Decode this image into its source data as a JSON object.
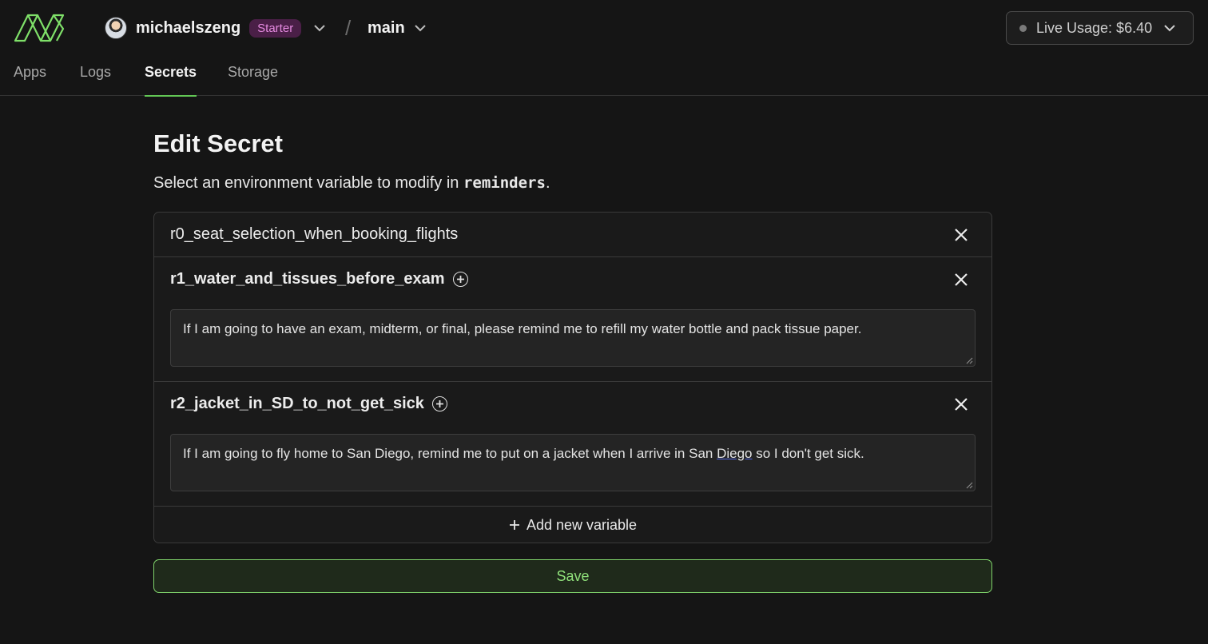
{
  "header": {
    "username": "michaelszeng",
    "plan_badge": "Starter",
    "separator": "/",
    "environment": "main",
    "live_usage": "Live Usage: $6.40"
  },
  "tabs": [
    {
      "label": "Apps",
      "active": false
    },
    {
      "label": "Logs",
      "active": false
    },
    {
      "label": "Secrets",
      "active": true
    },
    {
      "label": "Storage",
      "active": false
    }
  ],
  "main": {
    "title": "Edit Secret",
    "subtitle_prefix": "Select an environment variable to modify in ",
    "secret_name": "reminders",
    "subtitle_suffix": "."
  },
  "variables": [
    {
      "name": "r0_seat_selection_when_booking_flights",
      "expanded": false
    },
    {
      "name": "r1_water_and_tissues_before_exam",
      "expanded": true,
      "value": "If I am going to have an exam, midterm, or final, please remind me to refill my water bottle and pack tissue paper."
    },
    {
      "name": "r2_jacket_in_SD_to_not_get_sick",
      "expanded": true,
      "value_before": "If I am going to fly home to San Diego, remind me to put on a jacket when I arrive in San ",
      "value_flagged": "Diego",
      "value_after": " so I don't get sick."
    }
  ],
  "actions": {
    "add_variable": "Add new variable",
    "save": "Save"
  },
  "colors": {
    "background": "#151515",
    "accent_green": "#62c755",
    "badge_bg": "#4a1f47",
    "badge_text": "#e58ae0"
  },
  "icons": {
    "logo": "modal-logo-icon",
    "close": "close-icon",
    "add": "plus-circle-icon",
    "dropdown": "chevron-down-icon"
  }
}
